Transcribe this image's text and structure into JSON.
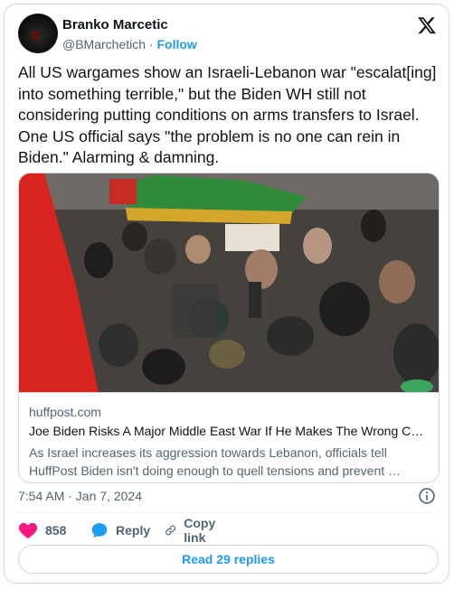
{
  "author": {
    "display_name": "Branko Marcetic",
    "handle": "@BMarchetich",
    "separator": "·",
    "follow_label": "Follow"
  },
  "tweet": {
    "text": "All US wargames show an Israeli-Lebanon war \"escalat[ing] into something terrible,\" but the Biden WH still not considering putting conditions on arms transfers to Israel. One US official says \"the problem is no one can rein in Biden.\" Alarming & damning."
  },
  "link_card": {
    "domain": "huffpost.com",
    "title": "Joe Biden Risks A Major Middle East War If He Makes The Wrong Cho…",
    "description": "As Israel increases its aggression towards Lebanon, officials tell HuffPost Biden isn't doing enough to quell tensions and prevent …"
  },
  "meta": {
    "timestamp": "7:54 AM · Jan 7, 2024"
  },
  "actions": {
    "like_count": "858",
    "reply_label": "Reply",
    "copy_label": "Copy link",
    "read_replies_label": "Read 29 replies"
  },
  "colors": {
    "accent": "#1d9bf0",
    "like": "#f91880",
    "text_primary": "#0f1419",
    "text_secondary": "#536471",
    "border": "#cfd9de"
  },
  "icons": [
    "x-logo-icon",
    "info-icon",
    "heart-icon",
    "reply-bubble-icon",
    "link-icon"
  ]
}
